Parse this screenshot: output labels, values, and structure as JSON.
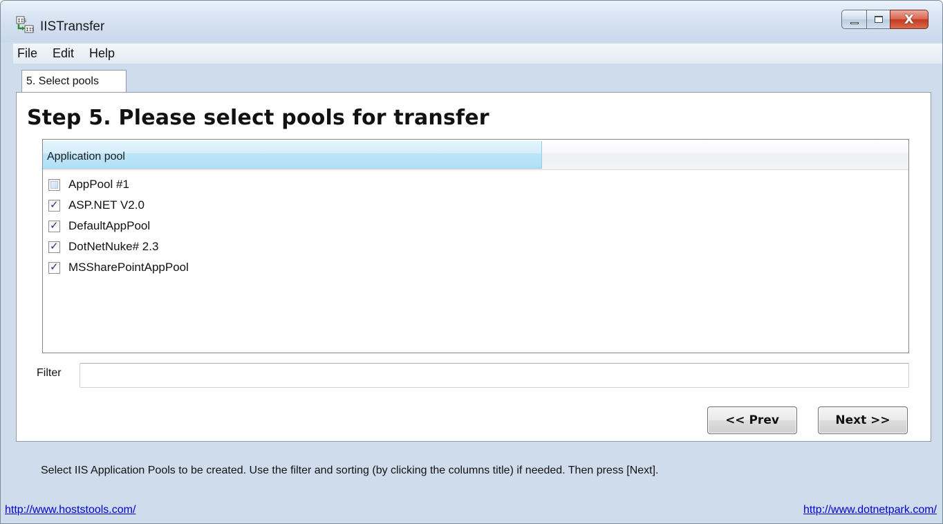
{
  "window": {
    "title": "IISTransfer",
    "close_glyph": "X",
    "icon": "app-transfer-icon"
  },
  "menu": {
    "items": [
      "File",
      "Edit",
      "Help"
    ]
  },
  "tab": {
    "label": "5. Select pools"
  },
  "main": {
    "heading": "Step 5. Please select pools for transfer",
    "list": {
      "column_header": "Application pool",
      "rows": [
        {
          "label": "AppPool #1",
          "checked": false
        },
        {
          "label": "ASP.NET V2.0",
          "checked": true
        },
        {
          "label": "DefaultAppPool",
          "checked": true
        },
        {
          "label": "DotNetNuke# 2.3",
          "checked": true
        },
        {
          "label": "MSSharePointAppPool",
          "checked": true
        }
      ]
    },
    "filter": {
      "label": "Filter",
      "value": ""
    },
    "buttons": {
      "prev": "<< Prev",
      "next": "Next >>"
    }
  },
  "status": {
    "text": "Select IIS Application Pools to be created. Use the filter and sorting (by clicking the columns title) if needed. Then press [Next].",
    "link_left": "http://www.hoststools.com/",
    "link_right": "http://www.dotnetpark.com/"
  },
  "colors": {
    "header_highlight": "#bde5f8",
    "link": "#0000cc",
    "close_button": "#c4391f"
  }
}
